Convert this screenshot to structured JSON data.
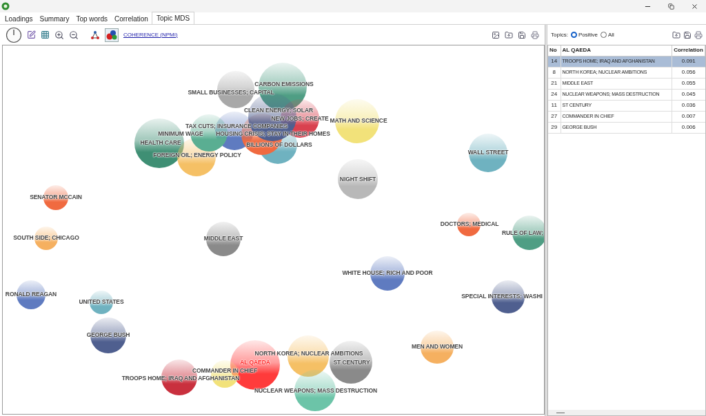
{
  "tabs": [
    {
      "label": "Loadings",
      "selected": false
    },
    {
      "label": "Summary",
      "selected": false
    },
    {
      "label": "Top words",
      "selected": false
    },
    {
      "label": "Correlation",
      "selected": false
    },
    {
      "label": "Topic MDS",
      "selected": true
    }
  ],
  "toolbar": {
    "bubble_toggle": {
      "on": true
    },
    "link": "COHERENCE (NPMI)"
  },
  "mds": {
    "bubbles": [
      {
        "label": "SMALL BUSINESSES; CAPITAL",
        "color": "#a8a8a8",
        "selected": false
      },
      {
        "label": "CARBON EMISSIONS",
        "color": "#4f9e84",
        "selected": false
      },
      {
        "label": "NEW JOBS; CREATE",
        "color": "#d9414f",
        "selected": false
      },
      {
        "label": "MATH AND SCIENCE",
        "color": "#f2e27a",
        "selected": false
      },
      {
        "label": "CLEAN ENERGY; SOLAR",
        "color": "#4f5f8f",
        "selected": false
      },
      {
        "label": "TAX CUTS; INSURANCE COMPANIES",
        "color": "#5aae92",
        "selected": false
      },
      {
        "label": "MINIMUM WAGE",
        "color": "#5f7bc0",
        "selected": false
      },
      {
        "label": "HOUSING CRISIS; STAY IN THEIR HOMES",
        "color": "#f06a40",
        "selected": false
      },
      {
        "label": "BILLIONS OF DOLLARS",
        "color": "#6fb2c0",
        "selected": false
      },
      {
        "label": "HEALTH CARE",
        "color": "#3f8f74",
        "selected": false
      },
      {
        "label": "FOREIGN OIL; ENERGY POLICY",
        "color": "#f5c065",
        "selected": false
      },
      {
        "label": "WALL STREET",
        "color": "#6fb2c0",
        "selected": false
      },
      {
        "label": "NIGHT SHIFT",
        "color": "#b8b8b8",
        "selected": false
      },
      {
        "label": "SENATOR MCCAIN",
        "color": "#f06a40",
        "selected": false
      },
      {
        "label": "DOCTORS; MEDICAL",
        "color": "#f06a40",
        "selected": false
      },
      {
        "label": "RULE OF LAW;",
        "color": "#4f9e84",
        "selected": false
      },
      {
        "label": "SOUTH SIDE; CHICAGO",
        "color": "#f5b060",
        "selected": false
      },
      {
        "label": "MIDDLE EAST",
        "color": "#8a8a8a",
        "selected": false
      },
      {
        "label": "WHITE HOUSE; RICH AND POOR",
        "color": "#5f7bc0",
        "selected": false
      },
      {
        "label": "RONALD REAGAN",
        "color": "#5f7bc0",
        "selected": false
      },
      {
        "label": "UNITED STATES",
        "color": "#6fb2c0",
        "selected": false
      },
      {
        "label": "SPECIAL INTERESTS; WASHI",
        "color": "#4f5f8f",
        "selected": false
      },
      {
        "label": "GEORGE BUSH",
        "color": "#4f5f8f",
        "selected": false
      },
      {
        "label": "MEN AND WOMEN",
        "color": "#f5b060",
        "selected": false
      },
      {
        "label": "NORTH KOREA; NUCLEAR AMBITIONS",
        "color": "#f5c065",
        "selected": false
      },
      {
        "label": "ST CENTURY",
        "color": "#8a8a8a",
        "selected": false
      },
      {
        "label": "AL QAEDA",
        "color": "#ff3b3b",
        "selected": true
      },
      {
        "label": "COMMANDER IN CHIEF",
        "color": "#f2e27a",
        "selected": false
      },
      {
        "label": "TROOPS HOME; IRAQ AND AFGHANISTAN",
        "color": "#c9303e",
        "selected": false
      },
      {
        "label": "NUCLEAR WEAPONS; MASS DESTRUCTION",
        "color": "#6cc4a8",
        "selected": false
      }
    ]
  },
  "topics_filter": {
    "label": "Topics:",
    "options": [
      {
        "label": "Positive",
        "selected": true
      },
      {
        "label": "All",
        "selected": false
      }
    ]
  },
  "table": {
    "columns": [
      "No",
      "AL QAEDA",
      "Correlation"
    ],
    "rows": [
      {
        "no": "14",
        "topic": "TROOPS HOME; IRAQ AND AFGHANISTAN",
        "correlation": "0.091",
        "selected": true
      },
      {
        "no": "8",
        "topic": "NORTH KOREA; NUCLEAR AMBITIONS",
        "correlation": "0.056",
        "selected": false
      },
      {
        "no": "21",
        "topic": "MIDDLE EAST",
        "correlation": "0.055",
        "selected": false
      },
      {
        "no": "24",
        "topic": "NUCLEAR WEAPONS; MASS DESTRUCTION",
        "correlation": "0.045",
        "selected": false
      },
      {
        "no": "11",
        "topic": "ST CENTURY",
        "correlation": "0.036",
        "selected": false
      },
      {
        "no": "27",
        "topic": "COMMANDER IN CHIEF",
        "correlation": "0.007",
        "selected": false
      },
      {
        "no": "29",
        "topic": "GEORGE BUSH",
        "correlation": "0.006",
        "selected": false
      }
    ]
  }
}
